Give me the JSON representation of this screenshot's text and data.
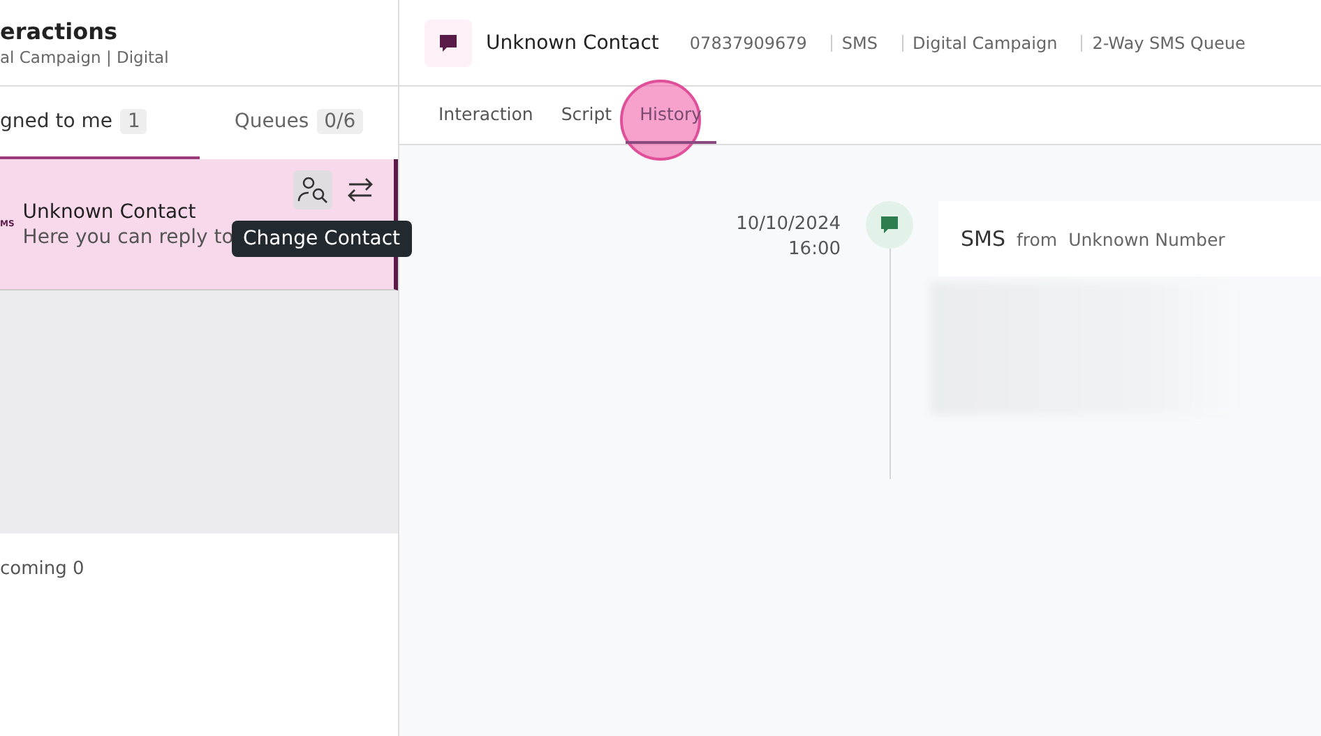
{
  "left_panel": {
    "title": "eractions",
    "subtitle": "al Campaign | Digital",
    "tabs": [
      {
        "label": "gned to me",
        "count": "1",
        "selected": true
      },
      {
        "label": "Queues",
        "count": "0/6",
        "selected": false
      }
    ],
    "items": [
      {
        "name": "Unknown Contact",
        "preview": "Here you can reply to",
        "channel": "MS",
        "selected": true
      }
    ],
    "tooltip": "Change Contact",
    "footer": "coming 0"
  },
  "contact": {
    "name": "Unknown Contact",
    "details": [
      "07837909679",
      "SMS",
      "Digital Campaign",
      "2-Way SMS Queue"
    ]
  },
  "tabs": [
    {
      "label": "Interaction",
      "selected": false
    },
    {
      "label": "Script",
      "selected": false
    },
    {
      "label": "History",
      "selected": true
    }
  ],
  "history": [
    {
      "date": "10/10/2024",
      "time": "16:00",
      "type": "SMS",
      "from_label": "from",
      "sender": "Unknown Number"
    }
  ]
}
